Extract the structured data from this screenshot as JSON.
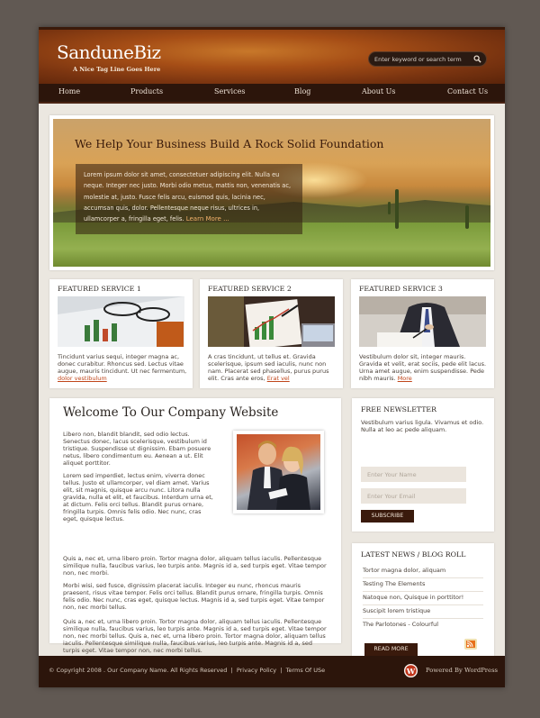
{
  "header": {
    "logo_title": "SanduneBiz",
    "logo_tagline": "A Nice Tag Line Goes Here",
    "search_placeholder": "Enter keyword or search term"
  },
  "nav": {
    "items": [
      "Home",
      "Products",
      "Services",
      "Blog",
      "About Us",
      "Contact Us"
    ]
  },
  "banner": {
    "title": "We Help Your Business Build A Rock Solid Foundation",
    "text": "Lorem ipsum dolor sit amet, consectetuer adipiscing elit. Nulla eu neque. Integer nec justo. Morbi odio metus, mattis non, venenatis ac, molestie at, justo. Fusce felis arcu, euismod quis, lacinia nec, accumsan quis, dolor. Pellentesque neque risus, ultrices in, ullamcorper a, fringilla eget, felis.",
    "more_link": "Learn More ..."
  },
  "services": [
    {
      "title": "FEATURED SERVICE 1",
      "text": "Tincidunt varius sequi, integer magna ac, donec curabitur. Rhoncus sed. Lectus vitae augue, mauris tincidunt. Ut nec fermentum,",
      "link": "dolor vestibulum"
    },
    {
      "title": "FEATURED SERVICE 2",
      "text": "A cras tincidunt, ut tellus et. Gravida scelerisque, ipsum sed iaculis, nunc non nam. Placerat sed phasellus, purus purus elit. Cras ante eros,",
      "link": "Erat vel"
    },
    {
      "title": "FEATURED SERVICE 3",
      "text": "Vestibulum dolor sit, integer mauris. Gravida et velit, erat sociis, pede elit lacus. Urna amet augue, enim suspendisse. Pede nibh mauris.",
      "link": "More"
    }
  ],
  "welcome": {
    "title": "Welcome To Our Company Website",
    "p1": "Libero non, blandit blandit, sed odio lectus. Senectus donec, lacus scelerisque, vestibulum id tristique. Suspendisse ut dignissim. Ebam posuere netus, libero condimentum eu. Aenean a ut. Elit aliquet porttitor.",
    "p2": "Lorem sed imperdiet, lectus enim, viverra donec tellus. Justo et ullamcorper, vel diam amet. Varius elit, sit magnis, quisque arcu nunc. Litora nulla gravida, nulla et elit, et faucibus. Interdum urna et, at dictum. Felis orci tellus. Blandit purus ornare, fringilla turpis. Omnis felis odio. Nec nunc, cras eget, quisque lectus.",
    "p3": "Quis a, nec et, urna libero proin. Tortor magna dolor, aliquam tellus iaculis. Pellentesque similique nulla, faucibus varius, leo turpis ante. Magnis id a, sed turpis eget. Vitae tempor non, nec morbi.",
    "p4": "Morbi wisi, sed fusce, dignissim placerat iaculis. Integer eu nunc, rhoncus mauris praesent, risus vitae tempor. Felis orci tellus. Blandit purus ornare, fringilla turpis. Omnis felis odio. Nec nunc, cras eget, quisque lectus. Magnis id a, sed turpis eget. Vitae tempor non, nec morbi tellus.",
    "p5": "Quis a, nec et, urna libero proin. Tortor magna dolor, aliquam tellus iaculis. Pellentesque similique nulla, faucibus varius, leo turpis ante. Magnis id a, sed turpis eget. Vitae tempor non, nec morbi tellus. Quis a, nec et, urna libero proin. Tortor magna dolor, aliquam tellus iaculis. Pellentesque similique nulla, faucibus varius, leo turpis ante. Magnis id a, sed turpis eget. Vitae tempor non, nec morbi tellus."
  },
  "newsletter": {
    "title": "FREE NEWSLETTER",
    "text": "Vestibulum varius ligula. Vivamus et odio. Nulla at leo ac pede aliquam.",
    "name_placeholder": "Enter Your Name",
    "email_placeholder": "Enter Your Email",
    "subscribe_label": "SUBSCRIBE"
  },
  "news": {
    "title": "LATEST NEWS / BLOG ROLL",
    "items": [
      "Tortor magna dolor, aliquam",
      "Testing The Elements",
      "Natoque non, Quisque in porttitor!",
      "Suscipit lorem tristique",
      "The Parlotones - Colourful"
    ],
    "read_more_label": "READ MORE"
  },
  "footer": {
    "copyright": "© Copyright 2008 . Our Company Name. All Rights Reserved",
    "privacy": "Privacy Policy",
    "terms": "Terms Of USe",
    "powered": "Powered By WordPress"
  },
  "colors": {
    "accent": "#c0461a",
    "dark_brown": "#2c150b",
    "background": "#615953"
  }
}
